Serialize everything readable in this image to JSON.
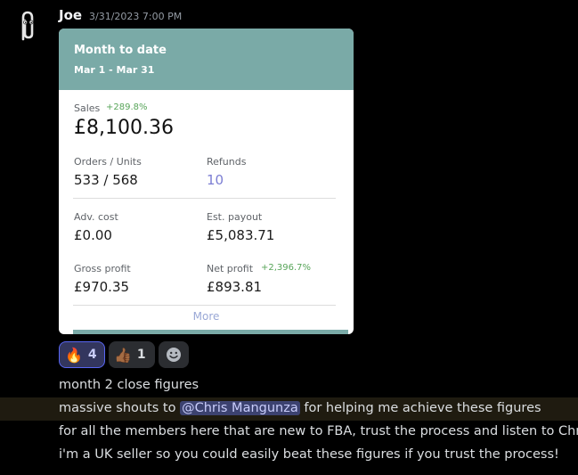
{
  "message": {
    "author": "Joe",
    "timestamp": "3/31/2023 7:00 PM",
    "avatar_icon": "paperclip-icon"
  },
  "card": {
    "title": "Month to date",
    "range": "Mar 1 - Mar 31",
    "accent_color": "#7aaaa7",
    "sales_label": "Sales",
    "sales_growth": "+289.8%",
    "sales_value": "£8,100.36",
    "orders_label": "Orders / Units",
    "orders_value": "533 / 568",
    "refunds_label": "Refunds",
    "refunds_value": "10",
    "adv_label": "Adv. cost",
    "adv_value": "£0.00",
    "payout_label": "Est. payout",
    "payout_value": "£5,083.71",
    "gross_label": "Gross profit",
    "gross_value": "£970.35",
    "net_label": "Net profit",
    "net_growth": "+2,396.7%",
    "net_value": "£893.81",
    "more_label": "More"
  },
  "reactions": [
    {
      "emoji": "🔥",
      "count": "4",
      "icon": "fire-icon"
    },
    {
      "emoji": "👍🏾",
      "count": "1",
      "icon": "thumbs-up-icon"
    }
  ],
  "add_reaction_icon": "smiley-icon",
  "lines": {
    "l1": "month 2 close figures",
    "l2_before": "massive shouts to ",
    "l2_mention": "@Chris Mangunza",
    "l2_after": " for helping me achieve these figures",
    "l3": "for all the members here that are new to FBA, trust the process and listen to Chris!",
    "l4": "i'm a UK seller so you could easily beat these figures if you trust the process!"
  }
}
